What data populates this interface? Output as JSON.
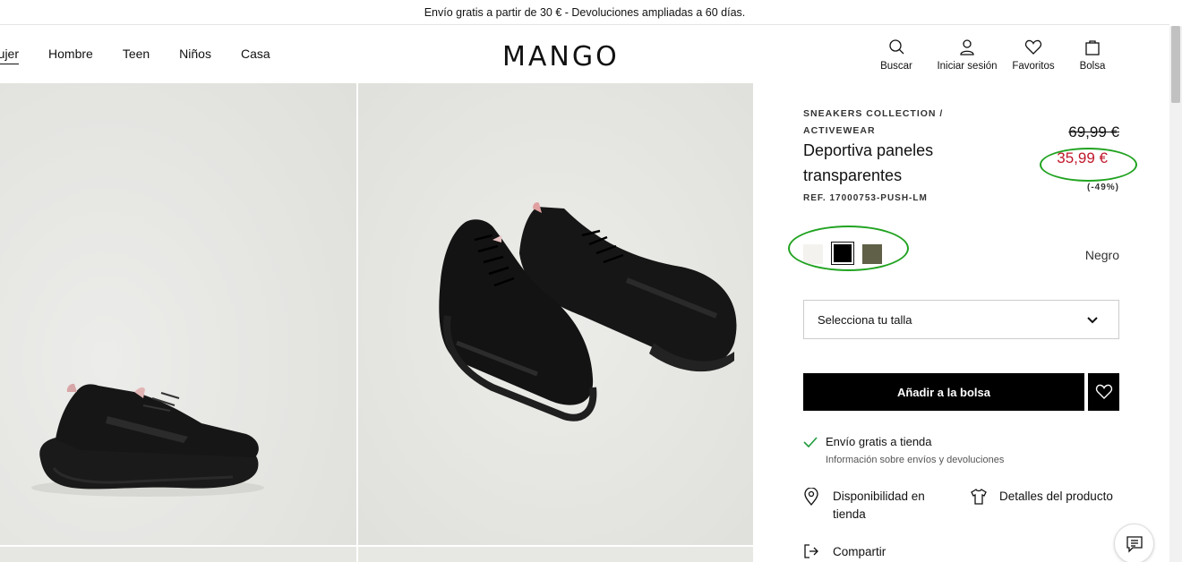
{
  "promo": {
    "text": "Envío gratis a partir de 30 € - Devoluciones ampliadas a 60 días."
  },
  "nav": {
    "items": [
      {
        "label": "Mujer"
      },
      {
        "label": "Hombre"
      },
      {
        "label": "Teen"
      },
      {
        "label": "Niños"
      },
      {
        "label": "Casa"
      }
    ]
  },
  "logo": {
    "text": "MANGO"
  },
  "actions": {
    "search": {
      "label": "Buscar",
      "icon": "search-icon"
    },
    "login": {
      "label": "Iniciar sesión",
      "icon": "user-icon"
    },
    "favorites": {
      "label": "Favoritos",
      "icon": "heart-icon"
    },
    "bag": {
      "label": "Bolsa",
      "icon": "bag-icon"
    }
  },
  "product": {
    "breadcrumb": "SNEAKERS COLLECTION / ACTIVEWEAR",
    "title": "Deportiva paneles transparentes",
    "ref": "REF. 17000753-PUSH-LM",
    "price_old": "69,99 €",
    "price_new": "35,99 €",
    "discount": "(-49%)",
    "colors": [
      {
        "name": "white-swatch",
        "hex": "#f3f2ee"
      },
      {
        "name": "black-swatch",
        "hex": "#000000"
      },
      {
        "name": "green-swatch",
        "hex": "#5f6047"
      }
    ],
    "selected_color": "Negro",
    "size_placeholder": "Selecciona tu talla",
    "add_to_bag": "Añadir a la bolsa",
    "shipping": "Envío gratis a tienda",
    "shipping_info": "Información sobre envíos y devoluciones",
    "availability": "Disponibilidad en tienda",
    "details": "Detalles del producto",
    "share": "Compartir"
  },
  "colors": {
    "sale_red": "#c0182b",
    "annotation_green": "#21a321",
    "button_black": "#000000"
  }
}
